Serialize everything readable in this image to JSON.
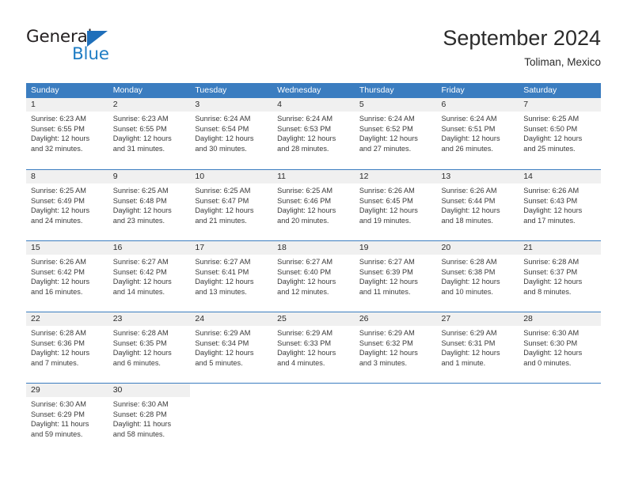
{
  "logo": {
    "word_top": "General",
    "word_bottom": "Blue",
    "triangle_color": "#1f6fba",
    "blue_color": "#1f7dc4"
  },
  "header": {
    "title": "September 2024",
    "subtitle": "Toliman, Mexico"
  },
  "colors": {
    "header_blue": "#3b7dc0",
    "daynum_band": "#f0f0f0",
    "text": "#3a3a3a"
  },
  "weekdays": [
    "Sunday",
    "Monday",
    "Tuesday",
    "Wednesday",
    "Thursday",
    "Friday",
    "Saturday"
  ],
  "weeks": [
    [
      {
        "day": "1",
        "sunrise": "Sunrise: 6:23 AM",
        "sunset": "Sunset: 6:55 PM",
        "daylight1": "Daylight: 12 hours",
        "daylight2": "and 32 minutes."
      },
      {
        "day": "2",
        "sunrise": "Sunrise: 6:23 AM",
        "sunset": "Sunset: 6:55 PM",
        "daylight1": "Daylight: 12 hours",
        "daylight2": "and 31 minutes."
      },
      {
        "day": "3",
        "sunrise": "Sunrise: 6:24 AM",
        "sunset": "Sunset: 6:54 PM",
        "daylight1": "Daylight: 12 hours",
        "daylight2": "and 30 minutes."
      },
      {
        "day": "4",
        "sunrise": "Sunrise: 6:24 AM",
        "sunset": "Sunset: 6:53 PM",
        "daylight1": "Daylight: 12 hours",
        "daylight2": "and 28 minutes."
      },
      {
        "day": "5",
        "sunrise": "Sunrise: 6:24 AM",
        "sunset": "Sunset: 6:52 PM",
        "daylight1": "Daylight: 12 hours",
        "daylight2": "and 27 minutes."
      },
      {
        "day": "6",
        "sunrise": "Sunrise: 6:24 AM",
        "sunset": "Sunset: 6:51 PM",
        "daylight1": "Daylight: 12 hours",
        "daylight2": "and 26 minutes."
      },
      {
        "day": "7",
        "sunrise": "Sunrise: 6:25 AM",
        "sunset": "Sunset: 6:50 PM",
        "daylight1": "Daylight: 12 hours",
        "daylight2": "and 25 minutes."
      }
    ],
    [
      {
        "day": "8",
        "sunrise": "Sunrise: 6:25 AM",
        "sunset": "Sunset: 6:49 PM",
        "daylight1": "Daylight: 12 hours",
        "daylight2": "and 24 minutes."
      },
      {
        "day": "9",
        "sunrise": "Sunrise: 6:25 AM",
        "sunset": "Sunset: 6:48 PM",
        "daylight1": "Daylight: 12 hours",
        "daylight2": "and 23 minutes."
      },
      {
        "day": "10",
        "sunrise": "Sunrise: 6:25 AM",
        "sunset": "Sunset: 6:47 PM",
        "daylight1": "Daylight: 12 hours",
        "daylight2": "and 21 minutes."
      },
      {
        "day": "11",
        "sunrise": "Sunrise: 6:25 AM",
        "sunset": "Sunset: 6:46 PM",
        "daylight1": "Daylight: 12 hours",
        "daylight2": "and 20 minutes."
      },
      {
        "day": "12",
        "sunrise": "Sunrise: 6:26 AM",
        "sunset": "Sunset: 6:45 PM",
        "daylight1": "Daylight: 12 hours",
        "daylight2": "and 19 minutes."
      },
      {
        "day": "13",
        "sunrise": "Sunrise: 6:26 AM",
        "sunset": "Sunset: 6:44 PM",
        "daylight1": "Daylight: 12 hours",
        "daylight2": "and 18 minutes."
      },
      {
        "day": "14",
        "sunrise": "Sunrise: 6:26 AM",
        "sunset": "Sunset: 6:43 PM",
        "daylight1": "Daylight: 12 hours",
        "daylight2": "and 17 minutes."
      }
    ],
    [
      {
        "day": "15",
        "sunrise": "Sunrise: 6:26 AM",
        "sunset": "Sunset: 6:42 PM",
        "daylight1": "Daylight: 12 hours",
        "daylight2": "and 16 minutes."
      },
      {
        "day": "16",
        "sunrise": "Sunrise: 6:27 AM",
        "sunset": "Sunset: 6:42 PM",
        "daylight1": "Daylight: 12 hours",
        "daylight2": "and 14 minutes."
      },
      {
        "day": "17",
        "sunrise": "Sunrise: 6:27 AM",
        "sunset": "Sunset: 6:41 PM",
        "daylight1": "Daylight: 12 hours",
        "daylight2": "and 13 minutes."
      },
      {
        "day": "18",
        "sunrise": "Sunrise: 6:27 AM",
        "sunset": "Sunset: 6:40 PM",
        "daylight1": "Daylight: 12 hours",
        "daylight2": "and 12 minutes."
      },
      {
        "day": "19",
        "sunrise": "Sunrise: 6:27 AM",
        "sunset": "Sunset: 6:39 PM",
        "daylight1": "Daylight: 12 hours",
        "daylight2": "and 11 minutes."
      },
      {
        "day": "20",
        "sunrise": "Sunrise: 6:28 AM",
        "sunset": "Sunset: 6:38 PM",
        "daylight1": "Daylight: 12 hours",
        "daylight2": "and 10 minutes."
      },
      {
        "day": "21",
        "sunrise": "Sunrise: 6:28 AM",
        "sunset": "Sunset: 6:37 PM",
        "daylight1": "Daylight: 12 hours",
        "daylight2": "and 8 minutes."
      }
    ],
    [
      {
        "day": "22",
        "sunrise": "Sunrise: 6:28 AM",
        "sunset": "Sunset: 6:36 PM",
        "daylight1": "Daylight: 12 hours",
        "daylight2": "and 7 minutes."
      },
      {
        "day": "23",
        "sunrise": "Sunrise: 6:28 AM",
        "sunset": "Sunset: 6:35 PM",
        "daylight1": "Daylight: 12 hours",
        "daylight2": "and 6 minutes."
      },
      {
        "day": "24",
        "sunrise": "Sunrise: 6:29 AM",
        "sunset": "Sunset: 6:34 PM",
        "daylight1": "Daylight: 12 hours",
        "daylight2": "and 5 minutes."
      },
      {
        "day": "25",
        "sunrise": "Sunrise: 6:29 AM",
        "sunset": "Sunset: 6:33 PM",
        "daylight1": "Daylight: 12 hours",
        "daylight2": "and 4 minutes."
      },
      {
        "day": "26",
        "sunrise": "Sunrise: 6:29 AM",
        "sunset": "Sunset: 6:32 PM",
        "daylight1": "Daylight: 12 hours",
        "daylight2": "and 3 minutes."
      },
      {
        "day": "27",
        "sunrise": "Sunrise: 6:29 AM",
        "sunset": "Sunset: 6:31 PM",
        "daylight1": "Daylight: 12 hours",
        "daylight2": "and 1 minute."
      },
      {
        "day": "28",
        "sunrise": "Sunrise: 6:30 AM",
        "sunset": "Sunset: 6:30 PM",
        "daylight1": "Daylight: 12 hours",
        "daylight2": "and 0 minutes."
      }
    ],
    [
      {
        "day": "29",
        "sunrise": "Sunrise: 6:30 AM",
        "sunset": "Sunset: 6:29 PM",
        "daylight1": "Daylight: 11 hours",
        "daylight2": "and 59 minutes."
      },
      {
        "day": "30",
        "sunrise": "Sunrise: 6:30 AM",
        "sunset": "Sunset: 6:28 PM",
        "daylight1": "Daylight: 11 hours",
        "daylight2": "and 58 minutes."
      },
      {
        "day": "",
        "sunrise": "",
        "sunset": "",
        "daylight1": "",
        "daylight2": ""
      },
      {
        "day": "",
        "sunrise": "",
        "sunset": "",
        "daylight1": "",
        "daylight2": ""
      },
      {
        "day": "",
        "sunrise": "",
        "sunset": "",
        "daylight1": "",
        "daylight2": ""
      },
      {
        "day": "",
        "sunrise": "",
        "sunset": "",
        "daylight1": "",
        "daylight2": ""
      },
      {
        "day": "",
        "sunrise": "",
        "sunset": "",
        "daylight1": "",
        "daylight2": ""
      }
    ]
  ]
}
